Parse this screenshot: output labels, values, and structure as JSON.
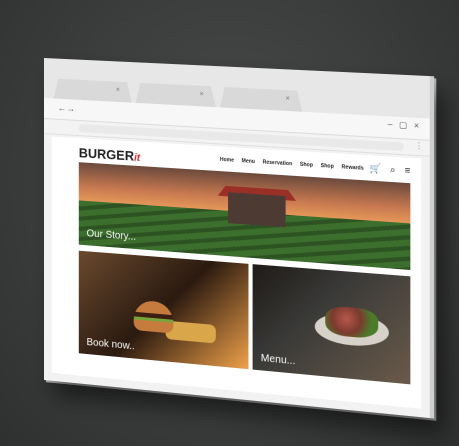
{
  "browser": {
    "tabs": [
      {
        "close": "×"
      },
      {
        "close": "×"
      },
      {
        "close": "×"
      }
    ],
    "nav": "←→",
    "window_controls": "– ▢ ×"
  },
  "site": {
    "logo_main": "BURGER",
    "logo_suffix": "it",
    "menu": [
      "Home",
      "Menu",
      "Reservation",
      "Shop",
      "Shop",
      "Rewards"
    ],
    "icons": [
      "cart-icon",
      "search-icon",
      "menu-icon"
    ]
  },
  "hero": {
    "label": "Our Story..."
  },
  "cards": [
    {
      "label": "Book now.."
    },
    {
      "label": "Menu..."
    }
  ]
}
